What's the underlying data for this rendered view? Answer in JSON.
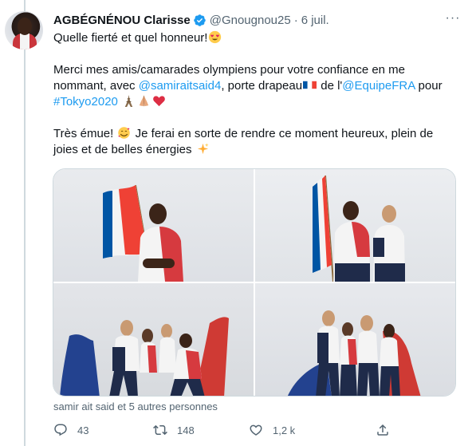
{
  "tweet": {
    "author_name": "AGBÉGNÉNOU Clarisse",
    "handle": "@Gnougnou25",
    "separator": "·",
    "date": "6 juil.",
    "more_label": "···",
    "line1": "Quelle fierté et quel honneur!",
    "p2_a": "Merci mes amis/camarades olympiens pour votre confiance en me nommant, avec ",
    "mention1": "@samiraitsaid4",
    "p2_b": ", porte drapeau",
    "p2_c": " de l'",
    "mention2": "@EquipeFRA",
    "p2_d": " pour ",
    "hashtag": "#Tokyo2020",
    "p3_a": "Très émue! ",
    "p3_b": " Je ferai en sorte de rendre ce moment heureux, plein de joies et de belles énergies ",
    "liked_by": "samir ait said et 5 autres personnes",
    "reply_count": "43",
    "retweet_count": "148",
    "like_count": "1,2 k"
  },
  "icons": {
    "verified": "verified-badge-icon",
    "emojis": [
      "heart-eyes-emoji",
      "france-flag-emoji",
      "eiffel-tower-emoji",
      "folded-hands-emoji",
      "red-heart-emoji",
      "smiling-hearts-emoji",
      "sparkles-emoji"
    ],
    "actions": [
      "reply-icon",
      "retweet-icon",
      "like-icon",
      "share-icon"
    ]
  },
  "colors": {
    "link": "#1d9bf0",
    "secondary_text": "#536471",
    "verified": "#1d9bf0",
    "flag_blue": "#0055a4",
    "flag_red": "#ef4135"
  }
}
